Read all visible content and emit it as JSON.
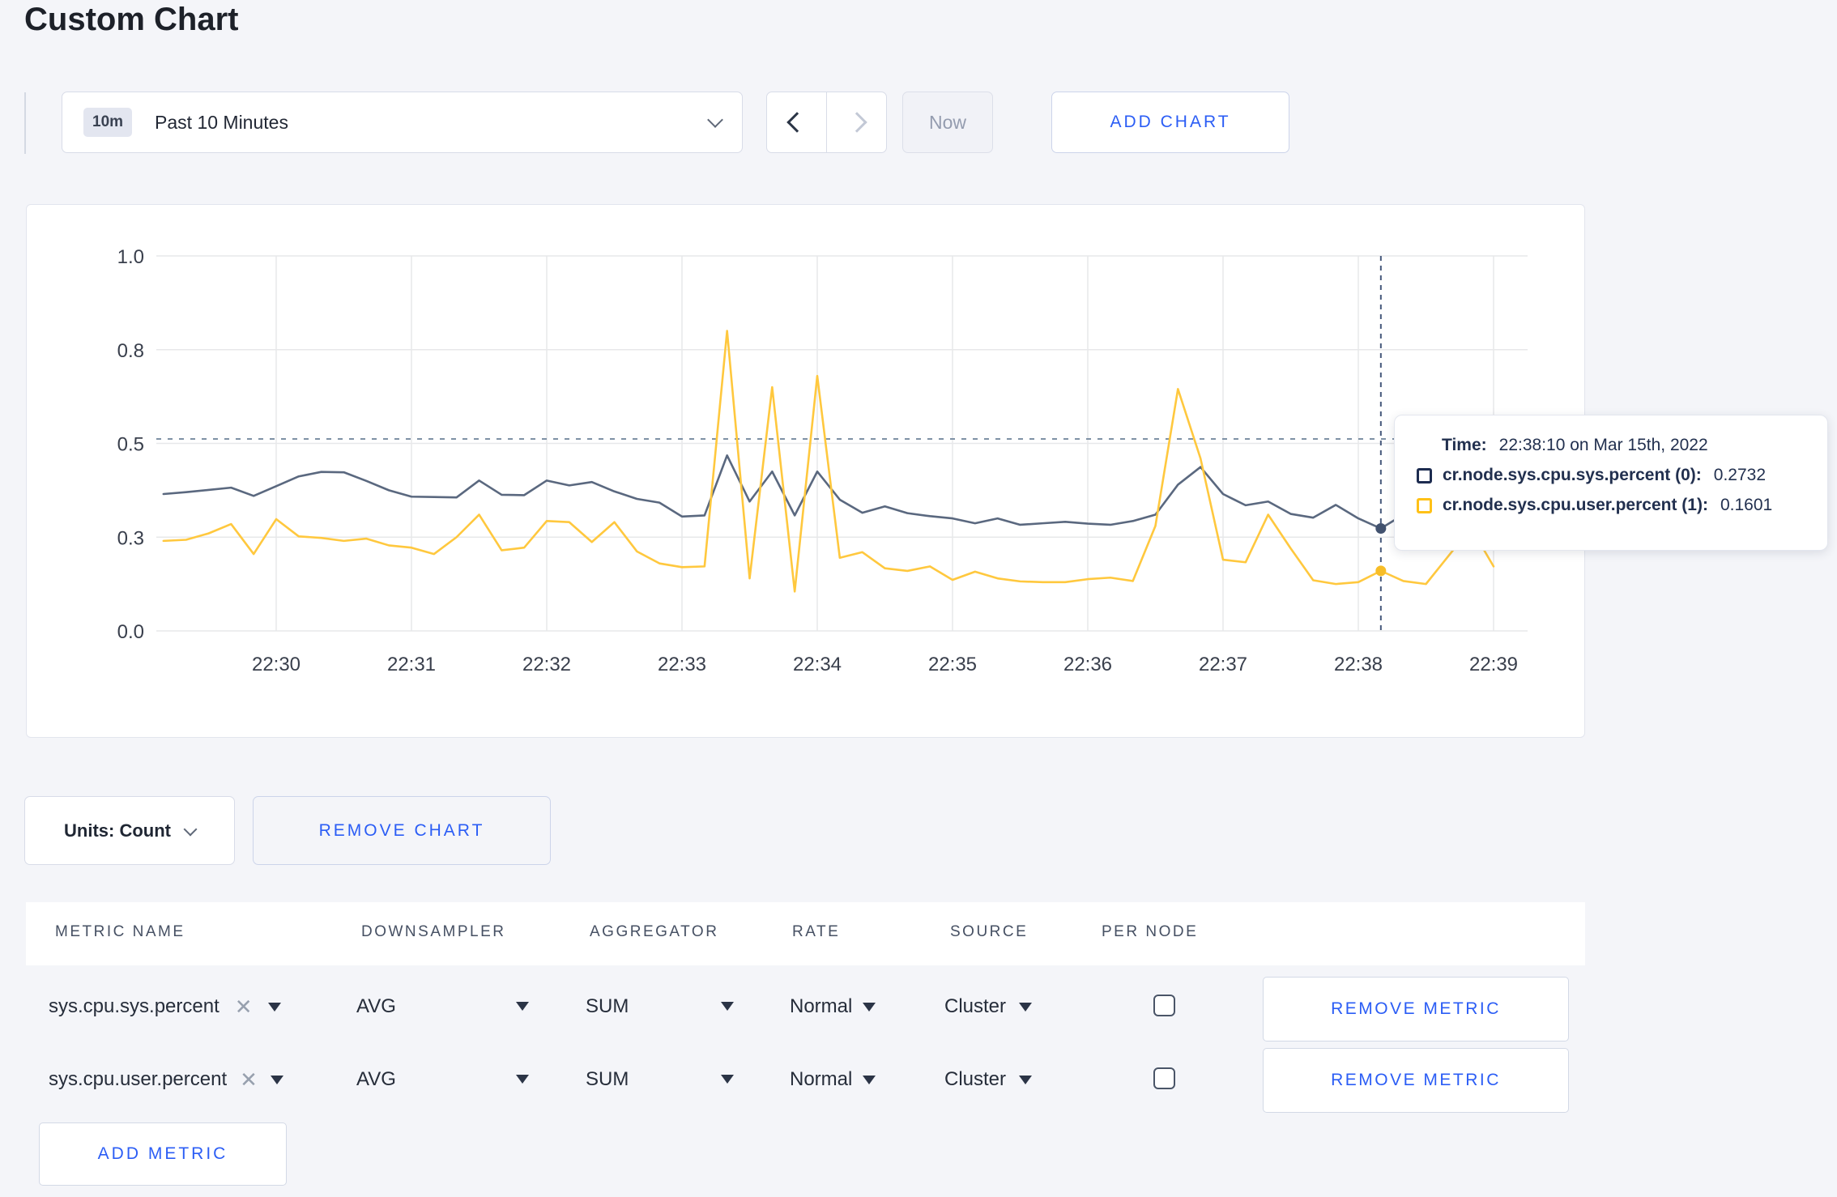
{
  "page": {
    "title": "Custom Chart"
  },
  "toolbar": {
    "time_window_badge": "10m",
    "time_window_label": "Past 10 Minutes",
    "now_label": "Now",
    "add_chart_label": "ADD CHART"
  },
  "tooltip": {
    "time_label": "Time:",
    "time_value": "22:38:10 on Mar 15th, 2022",
    "series": [
      {
        "label": "cr.node.sys.cpu.sys.percent (0):",
        "value": "0.2732",
        "swatch_color": "#1d2c50"
      },
      {
        "label": "cr.node.sys.cpu.user.percent (1):",
        "value": "0.1601",
        "swatch_color": "#ffc117"
      }
    ]
  },
  "chart_footer": {
    "units_label": "Units: Count",
    "remove_chart_label": "REMOVE CHART"
  },
  "metrics_table": {
    "headers": [
      "METRIC NAME",
      "DOWNSAMPLER",
      "AGGREGATOR",
      "RATE",
      "SOURCE",
      "PER NODE"
    ],
    "rows": [
      {
        "metric": "sys.cpu.sys.percent",
        "downsampler": "AVG",
        "aggregator": "SUM",
        "rate": "Normal",
        "source": "Cluster",
        "per_node_checked": false,
        "remove_label": "REMOVE METRIC"
      },
      {
        "metric": "sys.cpu.user.percent",
        "downsampler": "AVG",
        "aggregator": "SUM",
        "rate": "Normal",
        "source": "Cluster",
        "per_node_checked": false,
        "remove_label": "REMOVE METRIC"
      }
    ],
    "add_metric_label": "ADD METRIC"
  },
  "chart_data": {
    "type": "line",
    "title": "",
    "xlabel": "",
    "ylabel": "",
    "ylim": [
      0,
      1
    ],
    "grid": true,
    "legend_position": "tooltip-only",
    "x_unit": "seconds after 22:29:00 on Mar 15th, 2022",
    "y_ticks": [
      {
        "value": 0,
        "label": "0.0"
      },
      {
        "value": 0.25,
        "label": "0.3"
      },
      {
        "value": 0.5,
        "label": "0.5"
      },
      {
        "value": 0.75,
        "label": "0.8"
      },
      {
        "value": 1,
        "label": "1.0"
      }
    ],
    "x_ticks": [
      {
        "sec": 60,
        "label": "22:30"
      },
      {
        "sec": 120,
        "label": "22:31"
      },
      {
        "sec": 180,
        "label": "22:32"
      },
      {
        "sec": 240,
        "label": "22:33"
      },
      {
        "sec": 300,
        "label": "22:34"
      },
      {
        "sec": 360,
        "label": "22:35"
      },
      {
        "sec": 420,
        "label": "22:36"
      },
      {
        "sec": 480,
        "label": "22:37"
      },
      {
        "sec": 540,
        "label": "22:38"
      },
      {
        "sec": 600,
        "label": "22:39"
      }
    ],
    "threshold_value": 0.512,
    "crosshair": {
      "sec": 550,
      "time": "22:38:10"
    },
    "series": [
      {
        "name": "cr.node.sys.cpu.sys.percent",
        "color": "#5a687f",
        "dot_color": "#42526f",
        "highlight": {
          "sec": 550,
          "value": 0.2732
        },
        "points": [
          [
            10,
            0.365
          ],
          [
            20,
            0.37
          ],
          [
            30,
            0.376
          ],
          [
            40,
            0.382
          ],
          [
            50,
            0.36
          ],
          [
            60,
            0.386
          ],
          [
            70,
            0.412
          ],
          [
            80,
            0.424
          ],
          [
            90,
            0.423
          ],
          [
            100,
            0.4
          ],
          [
            110,
            0.375
          ],
          [
            120,
            0.358
          ],
          [
            130,
            0.357
          ],
          [
            140,
            0.356
          ],
          [
            150,
            0.401
          ],
          [
            160,
            0.363
          ],
          [
            170,
            0.362
          ],
          [
            180,
            0.401
          ],
          [
            190,
            0.388
          ],
          [
            200,
            0.397
          ],
          [
            210,
            0.372
          ],
          [
            220,
            0.352
          ],
          [
            230,
            0.342
          ],
          [
            240,
            0.305
          ],
          [
            250,
            0.308
          ],
          [
            260,
            0.468
          ],
          [
            270,
            0.345
          ],
          [
            280,
            0.425
          ],
          [
            290,
            0.308
          ],
          [
            300,
            0.425
          ],
          [
            310,
            0.35
          ],
          [
            320,
            0.315
          ],
          [
            330,
            0.332
          ],
          [
            340,
            0.314
          ],
          [
            350,
            0.306
          ],
          [
            360,
            0.3
          ],
          [
            370,
            0.287
          ],
          [
            380,
            0.3
          ],
          [
            390,
            0.283
          ],
          [
            400,
            0.287
          ],
          [
            410,
            0.291
          ],
          [
            420,
            0.286
          ],
          [
            430,
            0.283
          ],
          [
            440,
            0.293
          ],
          [
            450,
            0.31
          ],
          [
            460,
            0.39
          ],
          [
            470,
            0.437
          ],
          [
            480,
            0.365
          ],
          [
            490,
            0.335
          ],
          [
            500,
            0.345
          ],
          [
            510,
            0.312
          ],
          [
            520,
            0.302
          ],
          [
            530,
            0.336
          ],
          [
            540,
            0.3
          ],
          [
            550,
            0.2732
          ],
          [
            560,
            0.31
          ],
          [
            570,
            0.3
          ],
          [
            580,
            0.306
          ],
          [
            590,
            0.3
          ],
          [
            600,
            0.302
          ]
        ]
      },
      {
        "name": "cr.node.sys.cpu.user.percent",
        "color": "#ffc83e",
        "dot_color": "#f7bd27",
        "highlight": {
          "sec": 550,
          "value": 0.1601
        },
        "points": [
          [
            10,
            0.24
          ],
          [
            20,
            0.243
          ],
          [
            30,
            0.26
          ],
          [
            40,
            0.285
          ],
          [
            50,
            0.205
          ],
          [
            60,
            0.298
          ],
          [
            70,
            0.252
          ],
          [
            80,
            0.248
          ],
          [
            90,
            0.24
          ],
          [
            100,
            0.246
          ],
          [
            110,
            0.228
          ],
          [
            120,
            0.222
          ],
          [
            130,
            0.205
          ],
          [
            140,
            0.25
          ],
          [
            150,
            0.31
          ],
          [
            160,
            0.215
          ],
          [
            170,
            0.222
          ],
          [
            180,
            0.293
          ],
          [
            190,
            0.29
          ],
          [
            200,
            0.237
          ],
          [
            210,
            0.29
          ],
          [
            220,
            0.212
          ],
          [
            230,
            0.18
          ],
          [
            240,
            0.17
          ],
          [
            250,
            0.172
          ],
          [
            260,
            0.8
          ],
          [
            270,
            0.14
          ],
          [
            280,
            0.65
          ],
          [
            290,
            0.105
          ],
          [
            300,
            0.68
          ],
          [
            310,
            0.195
          ],
          [
            320,
            0.21
          ],
          [
            330,
            0.167
          ],
          [
            340,
            0.16
          ],
          [
            350,
            0.172
          ],
          [
            360,
            0.136
          ],
          [
            370,
            0.158
          ],
          [
            380,
            0.14
          ],
          [
            390,
            0.132
          ],
          [
            400,
            0.13
          ],
          [
            410,
            0.13
          ],
          [
            420,
            0.138
          ],
          [
            430,
            0.142
          ],
          [
            440,
            0.133
          ],
          [
            450,
            0.28
          ],
          [
            460,
            0.645
          ],
          [
            470,
            0.46
          ],
          [
            480,
            0.19
          ],
          [
            490,
            0.183
          ],
          [
            500,
            0.31
          ],
          [
            510,
            0.22
          ],
          [
            520,
            0.135
          ],
          [
            530,
            0.125
          ],
          [
            540,
            0.13
          ],
          [
            550,
            0.1601
          ],
          [
            560,
            0.133
          ],
          [
            570,
            0.125
          ],
          [
            580,
            0.2
          ],
          [
            590,
            0.275
          ],
          [
            600,
            0.172
          ]
        ]
      }
    ]
  }
}
